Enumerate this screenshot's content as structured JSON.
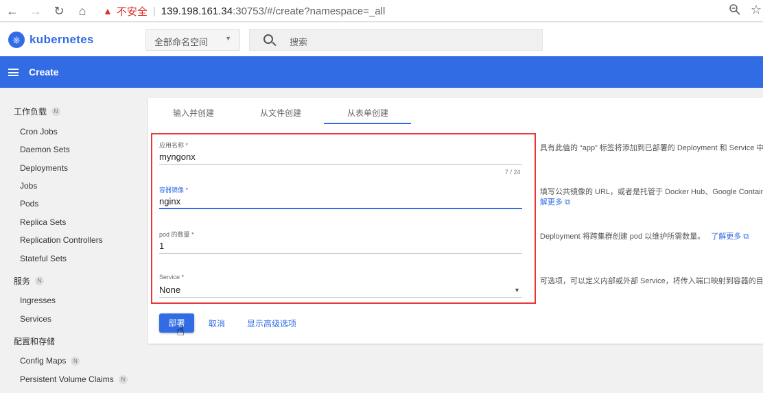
{
  "browser": {
    "insecure_label": "不安全",
    "url_host": "139.198.161.34",
    "url_path": ":30753/#/create?namespace=_all"
  },
  "app": {
    "brand": "kubernetes",
    "namespace_selected": "全部命名空间",
    "search_placeholder": "搜索",
    "page_title": "Create"
  },
  "sidebar": {
    "workloads": {
      "label": "工作负载",
      "badge": "N"
    },
    "workload_items": [
      "Cron Jobs",
      "Daemon Sets",
      "Deployments",
      "Jobs",
      "Pods",
      "Replica Sets",
      "Replication Controllers",
      "Stateful Sets"
    ],
    "services": {
      "label": "服务",
      "badge": "N"
    },
    "service_items": [
      "Ingresses",
      "Services"
    ],
    "config": {
      "label": "配置和存储"
    },
    "config_items": [
      {
        "label": "Config Maps",
        "badge": "N"
      },
      {
        "label": "Persistent Volume Claims",
        "badge": "N"
      }
    ]
  },
  "tabs": [
    "输入并创建",
    "从文件创建",
    "从表单创建"
  ],
  "form": {
    "app_name": {
      "label": "应用名称 *",
      "value": "myngonx",
      "counter": "7 / 24"
    },
    "image": {
      "label": "容器镜像 *",
      "value": "nginx"
    },
    "pods": {
      "label": "pod 的数量 *",
      "value": "1"
    },
    "service": {
      "label": "Service *",
      "value": "None"
    }
  },
  "help": {
    "app_name": "具有此值的 “app” 标签将添加到已部署的 Deployment 和 Service 中",
    "image_line1": "填写公共镜像的 URL，或者是托管于 Docker Hub、Google Contain",
    "image_link": "解更多",
    "pods_text": "Deployment 将跨集群创建 pod 以维护所需数量。",
    "pods_link": "了解更多",
    "service": "可选项，可以定义内部或外部 Service，将传入端口映射到容器的目"
  },
  "actions": {
    "deploy": "部署",
    "cancel": "取消",
    "advanced": "显示高级选项"
  },
  "colors": {
    "accent": "#326ce5",
    "highlight_box": "#e53935"
  }
}
